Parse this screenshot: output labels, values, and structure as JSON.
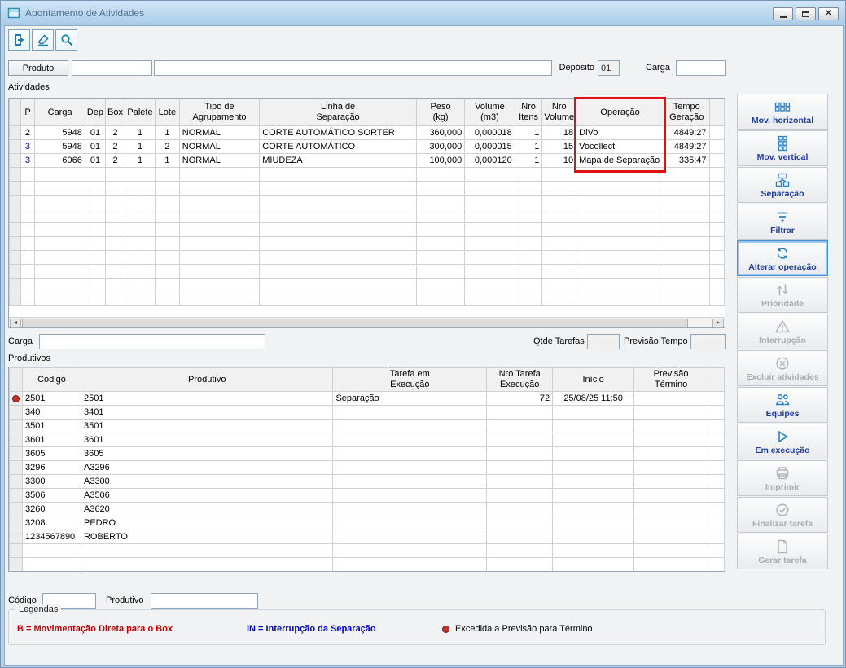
{
  "window": {
    "title": "Apontamento de Atividades"
  },
  "toolbar": {
    "buttons": [
      {
        "name": "exit",
        "icon": "exit-icon"
      },
      {
        "name": "clear",
        "icon": "eraser-icon"
      },
      {
        "name": "search",
        "icon": "search-icon"
      }
    ]
  },
  "filter_bar": {
    "produto_button": "Produto",
    "produto_code_value": "",
    "produto_name_value": "",
    "deposito_label": "Depósito",
    "deposito_value": "01",
    "carga_label": "Carga",
    "carga_value": ""
  },
  "atividades": {
    "section_label": "Atividades",
    "columns": [
      "P",
      "Carga",
      "Dep",
      "Box",
      "Palete",
      "Lote",
      "Tipo de\nAgrupamento",
      "Linha de\nSeparação",
      "Peso\n(kg)",
      "Volume\n(m3)",
      "Nro\nItens",
      "Nro\nVolume",
      "Operação",
      "Tempo\nGeração"
    ],
    "rows": [
      [
        "2",
        "5948",
        "01",
        "2",
        "1",
        "1",
        "NORMAL",
        "CORTE AUTOMÁTICO SORTER",
        "360,000",
        "0,000018",
        "1",
        "18",
        "DiVo",
        "4849:27"
      ],
      [
        "3",
        "5948",
        "01",
        "2",
        "1",
        "2",
        "NORMAL",
        "CORTE AUTOMÁTICO",
        "300,000",
        "0,000015",
        "1",
        "15",
        "Vocollect",
        "4849:27"
      ],
      [
        "3",
        "6066",
        "01",
        "2",
        "1",
        "1",
        "NORMAL",
        "MIUDEZA",
        "100,000",
        "0,000120",
        "1",
        "10",
        "Mapa de Separação",
        "335:47"
      ]
    ],
    "p_colors": [
      "#000000",
      "#0000c8",
      "#0000c8"
    ],
    "highlight": {
      "column": "Operação",
      "color": "#e01010"
    }
  },
  "carga_bar": {
    "carga_label": "Carga",
    "carga_value": "",
    "qtde_tarefas_label": "Qtde Tarefas",
    "qtde_tarefas_value": "",
    "previsao_tempo_label": "Previsão Tempo",
    "previsao_tempo_value": ""
  },
  "produtivos": {
    "section_label": "Produtivos",
    "columns": [
      "Código",
      "Produtivo",
      "Tarefa em\nExecução",
      "Nro Tarefa\nExecução",
      "Início",
      "Previsão\nTérmino"
    ],
    "rows": [
      [
        "2501",
        "2501",
        "Separação",
        "72",
        "25/08/25  11:50",
        ""
      ],
      [
        "340",
        "3401",
        "",
        "",
        "",
        ""
      ],
      [
        "3501",
        "3501",
        "",
        "",
        "",
        ""
      ],
      [
        "3601",
        "3601",
        "",
        "",
        "",
        ""
      ],
      [
        "3605",
        "3605",
        "",
        "",
        "",
        ""
      ],
      [
        "3296",
        "A3296",
        "",
        "",
        "",
        ""
      ],
      [
        "3300",
        "A3300",
        "",
        "",
        "",
        ""
      ],
      [
        "3506",
        "A3506",
        "",
        "",
        "",
        ""
      ],
      [
        "3260",
        "A3620",
        "",
        "",
        "",
        ""
      ],
      [
        "3208",
        "PEDRO",
        "",
        "",
        "",
        ""
      ],
      [
        "1234567890",
        "ROBERTO",
        "",
        "",
        "",
        ""
      ]
    ],
    "overdue_row_index": 0,
    "overdue_color": "#c7342c"
  },
  "bottom_bar": {
    "codigo_label": "Código",
    "codigo_value": "",
    "produtivo_label": "Produtivo",
    "produtivo_value": ""
  },
  "legendas": {
    "title": "Legendas",
    "items": [
      {
        "text": "B = Movimentação Direta para o Box",
        "color": "#c00000",
        "bold": true
      },
      {
        "text": "IN = Interrupção da Separação",
        "color": "#0000c8",
        "bold": true
      },
      {
        "text": "Excedida a Previsão para Término",
        "color": "#000000",
        "bold": false,
        "marker": "red-dot-icon"
      }
    ]
  },
  "sidebar": {
    "buttons": [
      {
        "label": "Mov. horizontal",
        "icon": "grid-horizontal-icon",
        "enabled": true
      },
      {
        "label": "Mov. vertical",
        "icon": "grid-vertical-icon",
        "enabled": true
      },
      {
        "label": "Separação",
        "icon": "separation-icon",
        "enabled": true
      },
      {
        "label": "Filtrar",
        "icon": "filter-icon",
        "enabled": true
      },
      {
        "label": "Alterar operação",
        "icon": "refresh-icon",
        "enabled": true,
        "focused": true
      },
      {
        "label": "Prioridade",
        "icon": "priority-arrows-icon",
        "enabled": false
      },
      {
        "label": "Interrupção",
        "icon": "warning-icon",
        "enabled": false
      },
      {
        "label": "Excluir atividades",
        "icon": "cancel-circle-icon",
        "enabled": false
      },
      {
        "label": "Equipes",
        "icon": "people-icon",
        "enabled": true
      },
      {
        "label": "Em execução",
        "icon": "play-icon",
        "enabled": true
      },
      {
        "label": "Imprimir",
        "icon": "printer-icon",
        "enabled": false
      },
      {
        "label": "Finalizar tarefa",
        "icon": "check-circle-icon",
        "enabled": false
      },
      {
        "label": "Gerar tarefa",
        "icon": "document-icon",
        "enabled": false
      }
    ]
  },
  "colors": {
    "titlebar": "#a9cbe9",
    "accent_label_blue": "#1e3a9f",
    "icon_teal": "#1b7fae",
    "annotation_red": "#e01010"
  }
}
